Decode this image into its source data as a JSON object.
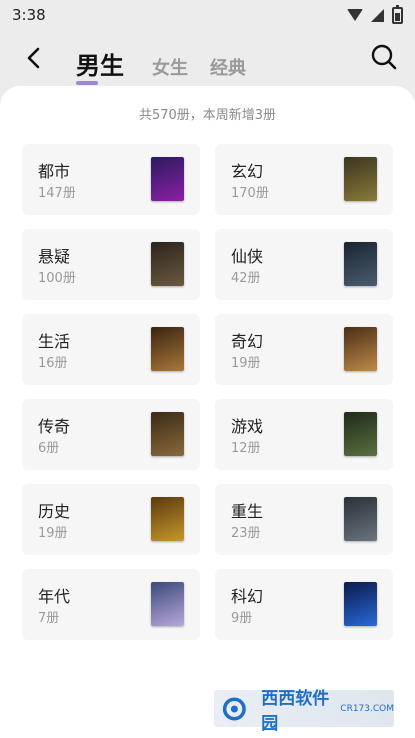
{
  "status_bar": {
    "time": "3:38"
  },
  "header": {
    "tabs": [
      {
        "label": "男生",
        "active": true
      },
      {
        "label": "女生",
        "active": false
      },
      {
        "label": "经典",
        "active": false
      }
    ]
  },
  "summary": "共570册，本周新增3册",
  "categories": [
    {
      "name": "都市",
      "count": "147册",
      "cover_colors": [
        "#2a1b5e",
        "#8d1fa6"
      ]
    },
    {
      "name": "玄幻",
      "count": "170册",
      "cover_colors": [
        "#3a3520",
        "#8a7a3a"
      ]
    },
    {
      "name": "悬疑",
      "count": "100册",
      "cover_colors": [
        "#2b241c",
        "#6a5a40"
      ]
    },
    {
      "name": "仙侠",
      "count": "42册",
      "cover_colors": [
        "#1a2430",
        "#4a5d70"
      ]
    },
    {
      "name": "生活",
      "count": "16册",
      "cover_colors": [
        "#3b2412",
        "#a87838"
      ]
    },
    {
      "name": "奇幻",
      "count": "19册",
      "cover_colors": [
        "#4a2e16",
        "#c08a4a"
      ]
    },
    {
      "name": "传奇",
      "count": "6册",
      "cover_colors": [
        "#3a2a18",
        "#8a6a3a"
      ]
    },
    {
      "name": "游戏",
      "count": "12册",
      "cover_colors": [
        "#1f2a1a",
        "#5a7040"
      ]
    },
    {
      "name": "历史",
      "count": "19册",
      "cover_colors": [
        "#5a3a10",
        "#c8982a"
      ]
    },
    {
      "name": "重生",
      "count": "23册",
      "cover_colors": [
        "#2a3038",
        "#6a7580"
      ]
    },
    {
      "name": "年代",
      "count": "7册",
      "cover_colors": [
        "#3a4a7a",
        "#b8a8d8"
      ]
    },
    {
      "name": "科幻",
      "count": "9册",
      "cover_colors": [
        "#0a1a4a",
        "#2a6ad8"
      ]
    }
  ],
  "watermark": {
    "text": "西西软件园",
    "sub": "CR173.COM"
  },
  "colors": {
    "accent": "#7c5cd6",
    "card_bg": "#f6f6f6"
  }
}
